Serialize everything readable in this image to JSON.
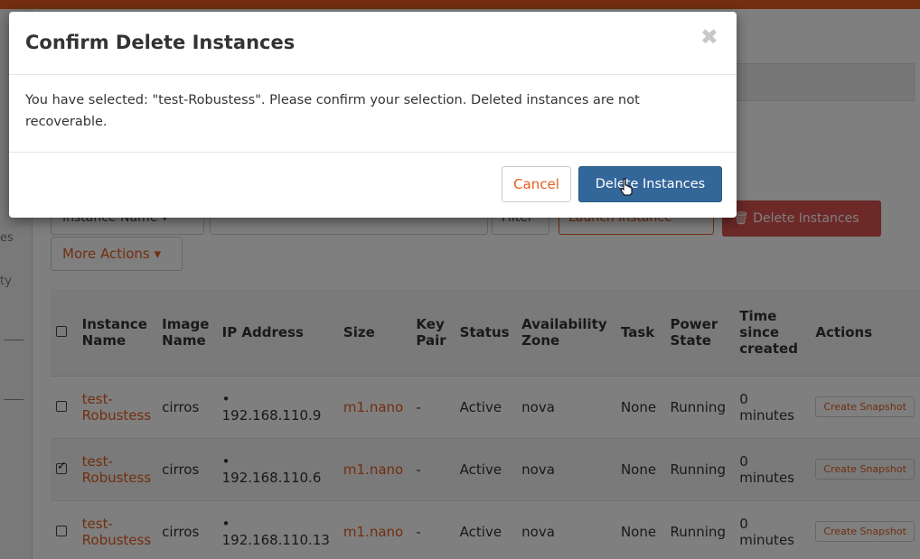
{
  "page": {
    "filter_select_label": "Instance Name",
    "filter_button_label": "Filter",
    "launch_button_label": "Launch Instance",
    "delete_button_label": "Delete Instances",
    "more_actions_label": "More Actions"
  },
  "table": {
    "headers": [
      "Instance Name",
      "Image Name",
      "IP Address",
      "Size",
      "Key Pair",
      "Status",
      "Availability Zone",
      "Task",
      "Power State",
      "Time since created",
      "Actions"
    ],
    "rows": [
      {
        "name": "test-Robustess",
        "image": "cirros",
        "ip": "192.168.110.9",
        "size": "m1.nano",
        "key_pair": "-",
        "status": "Active",
        "zone": "nova",
        "task": "None",
        "power": "Running",
        "time": "0 minutes",
        "action": "Create Snapshot",
        "checked": false
      },
      {
        "name": "test-Robustess",
        "image": "cirros",
        "ip": "192.168.110.6",
        "size": "m1.nano",
        "key_pair": "-",
        "status": "Active",
        "zone": "nova",
        "task": "None",
        "power": "Running",
        "time": "0 minutes",
        "action": "Create Snapshot",
        "checked": true
      },
      {
        "name": "test-Robustess",
        "image": "cirros",
        "ip": "192.168.110.13",
        "size": "m1.nano",
        "key_pair": "-",
        "status": "Active",
        "zone": "nova",
        "task": "None",
        "power": "Running",
        "time": "0 minutes",
        "action": "Create Snapshot",
        "checked": false
      }
    ]
  },
  "modal": {
    "title": "Confirm Delete Instances",
    "close_glyph": "✖",
    "body_text": "You have selected: \"test-Robustess\". Please confirm your selection. Deleted instances are not recoverable.",
    "cancel_label": "Cancel",
    "confirm_label": "Delete Instances"
  },
  "colors": {
    "accent": "#e45d1f",
    "danger": "#d9534f",
    "primary": "#336699"
  }
}
